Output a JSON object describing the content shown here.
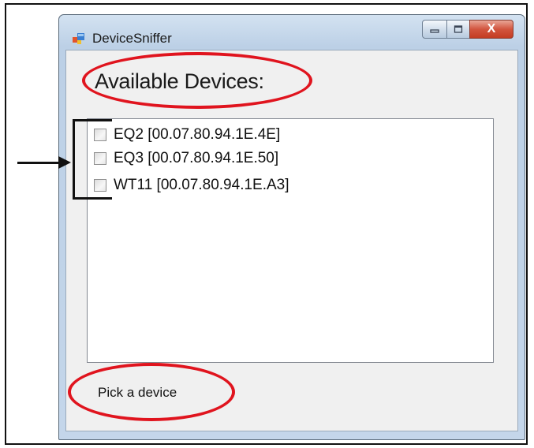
{
  "window": {
    "title": "DeviceSniffer",
    "buttons": {
      "minimize_icon": "minimize-icon",
      "maximize_icon": "maximize-icon",
      "close_icon": "close-icon"
    },
    "close_glyph": "X"
  },
  "main": {
    "heading": "Available Devices:",
    "devices": [
      {
        "label": "EQ2  [00.07.80.94.1E.4E]",
        "checked": false
      },
      {
        "label": "EQ3  [00.07.80.94.1E.50]",
        "checked": false
      },
      {
        "label": "WT11  [00.07.80.94.1E.A3]",
        "checked": false
      }
    ],
    "status": "Pick a device"
  },
  "colors": {
    "highlight_ellipse": "#e0141e",
    "close_button": "#c43c22"
  }
}
